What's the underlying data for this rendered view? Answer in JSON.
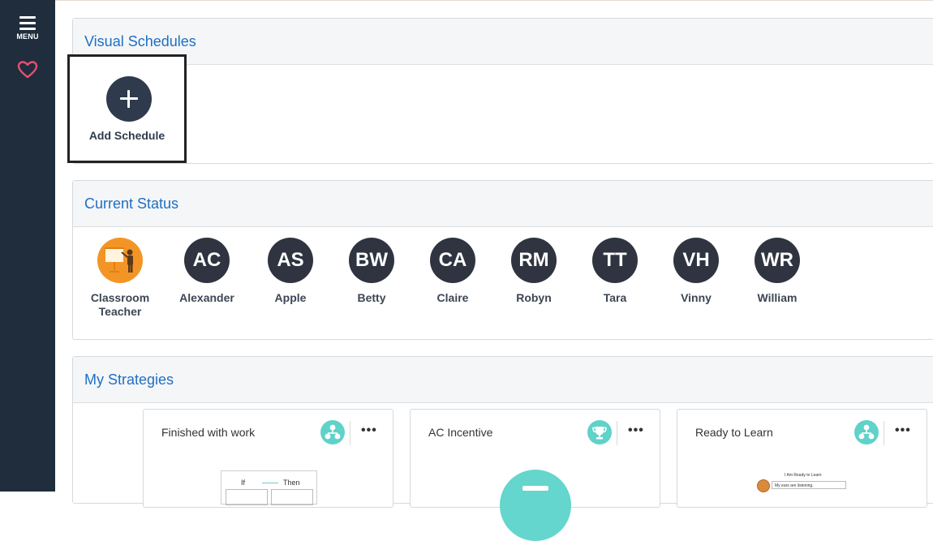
{
  "sidebar": {
    "menu_label": "MENU",
    "menu_icon": "hamburger-icon",
    "favorites_icon": "heart-icon",
    "accent": "#e84e70",
    "background": "#1f2d3d"
  },
  "visual_schedules": {
    "title": "Visual Schedules",
    "add_label": "Add Schedule",
    "add_icon": "plus-icon"
  },
  "current_status": {
    "title": "Current Status",
    "people": [
      {
        "name": "Classroom Teacher",
        "initials": "",
        "icon": "teacher-icon",
        "color": "#f39526"
      },
      {
        "name": "Alexander",
        "initials": "AC"
      },
      {
        "name": "Apple",
        "initials": "AS"
      },
      {
        "name": "Betty",
        "initials": "BW"
      },
      {
        "name": "Claire",
        "initials": "CA"
      },
      {
        "name": "Robyn",
        "initials": "RM"
      },
      {
        "name": "Tara",
        "initials": "TT"
      },
      {
        "name": "Vinny",
        "initials": "VH"
      },
      {
        "name": "William",
        "initials": "WR"
      }
    ]
  },
  "strategies": {
    "title": "My Strategies",
    "more_label": "•••",
    "cards": [
      {
        "title": "Finished with work",
        "icon": "flow-icon",
        "thumb": {
          "if_label": "If",
          "then_label": "Then"
        }
      },
      {
        "title": "AC Incentive",
        "icon": "trophy-icon"
      },
      {
        "title": "Ready to Learn",
        "icon": "flow-icon",
        "thumb": {
          "title": "I Am Ready to Learn",
          "row": "My ears are listening."
        }
      }
    ]
  },
  "colors": {
    "title_blue": "#1f6fc4",
    "avatar_dark": "#2f3440",
    "teal": "#5fd2c9"
  }
}
